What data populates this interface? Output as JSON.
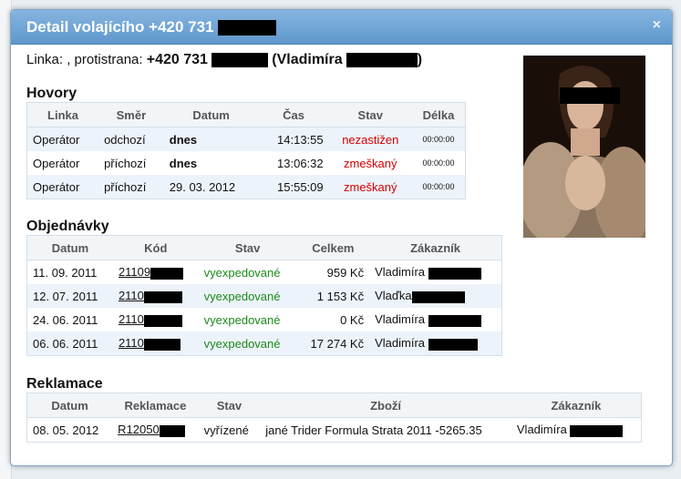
{
  "dialog": {
    "title_prefix": "Detail volajícího +420 731",
    "close_glyph": "×"
  },
  "line_info": {
    "prefix": "Linka: , protistrana: ",
    "number_prefix": "+420 731",
    "name_prefix": "(Vladimíra",
    "name_suffix": ")"
  },
  "hovory": {
    "title": "Hovory",
    "headers": [
      "Linka",
      "Směr",
      "Datum",
      "Čas",
      "Stav",
      "Délka"
    ],
    "rows": [
      {
        "linka": "Operátor",
        "smer": "odchozí",
        "datum": "dnes",
        "cas": "14:13:55",
        "stav": "nezastižen",
        "delka": "00:00:00"
      },
      {
        "linka": "Operátor",
        "smer": "příchozí",
        "datum": "dnes",
        "cas": "13:06:32",
        "stav": "zmeškaný",
        "delka": "00:00:00"
      },
      {
        "linka": "Operátor",
        "smer": "příchozí",
        "datum": "29. 03. 2012",
        "cas": "15:55:09",
        "stav": "zmeškaný",
        "delka": "00:00:00"
      }
    ]
  },
  "objednavky": {
    "title": "Objednávky",
    "headers": [
      "Datum",
      "Kód",
      "Stav",
      "Celkem",
      "Zákazník"
    ],
    "rows": [
      {
        "datum": "11. 09. 2011",
        "kod": "21109",
        "stav": "vyexpedované",
        "celkem": "959 Kč",
        "zakaznik": "Vladimíra"
      },
      {
        "datum": "12. 07. 2011",
        "kod": "2110",
        "stav": "vyexpedované",
        "celkem": "1 153 Kč",
        "zakaznik": "Vlaďka"
      },
      {
        "datum": "24. 06. 2011",
        "kod": "2110",
        "stav": "vyexpedované",
        "celkem": "0 Kč",
        "zakaznik": "Vladimíra"
      },
      {
        "datum": "06. 06. 2011",
        "kod": "2110",
        "stav": "vyexpedované",
        "celkem": "17 274 Kč",
        "zakaznik": "Vladimíra"
      }
    ]
  },
  "reklamace": {
    "title": "Reklamace",
    "headers": [
      "Datum",
      "Reklamace",
      "Stav",
      "Zboží",
      "Zákazník"
    ],
    "rows": [
      {
        "datum": "08. 05. 2012",
        "reklamace": "R12050",
        "stav": "vyřízené",
        "zbozi": "jané Trider Formula Strata 2011 -5265.35",
        "zakaznik": "Vladimíra"
      }
    ]
  },
  "colors": {
    "titlebar": "#6fa3d5",
    "missed": "#d40000",
    "shipped": "#1c8a1c",
    "alt_row": "#edf3fa"
  }
}
